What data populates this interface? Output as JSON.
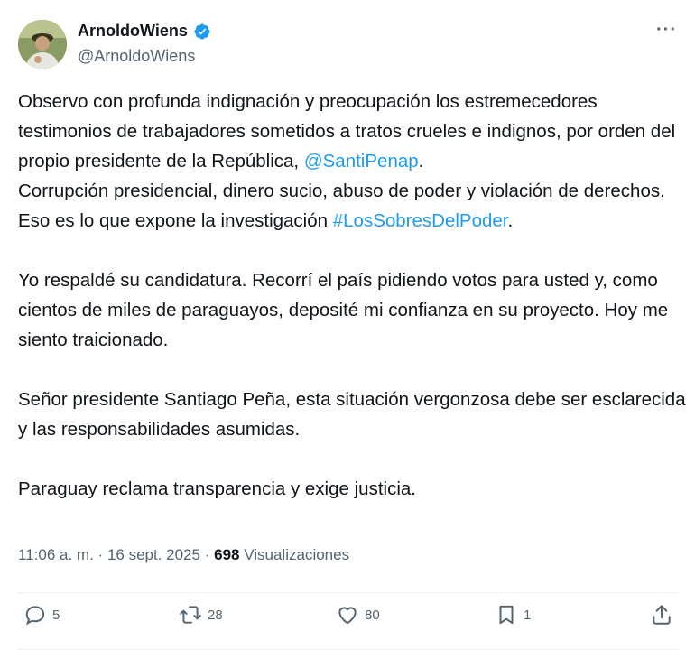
{
  "author": {
    "display_name": "ArnoldoWiens",
    "handle": "@ArnoldoWiens",
    "verified_icon": "verified-badge-icon"
  },
  "more_label": "···",
  "tweet": {
    "p1_text_a": "Observo con profunda indignación y preocupación los estremecedores testimonios de trabajadores sometidos a tratos crueles e indignos, por orden del propio presidente de la República, ",
    "p1_mention": "@SantiPenap",
    "p1_text_b": ".",
    "p2_text_a": "Corrupción presidencial, dinero sucio, abuso de poder y violación de derechos. Eso es lo que expone la investigación ",
    "p2_hashtag": "#LosSobresDelPoder",
    "p2_text_b": ".",
    "p3": "Yo respaldé su candidatura. Recorrí el país pidiendo votos para usted y, como cientos de miles de paraguayos, deposité mi confianza en su proyecto. Hoy me siento traicionado.",
    "p4": "Señor presidente Santiago Peña, esta situación vergonzosa debe ser esclarecida y las responsabilidades asumidas.",
    "p5": "Paraguay reclama transparencia y exige justicia."
  },
  "meta": {
    "time": "11:06 a. m.",
    "separator": "·",
    "date": "16 sept. 2025",
    "views_count": "698",
    "views_label": "Visualizaciones"
  },
  "actions": {
    "replies": "5",
    "reposts": "28",
    "likes": "80",
    "bookmarks": "1"
  },
  "colors": {
    "link": "#1d9bf0",
    "text": "#0f1419",
    "secondary": "#536471",
    "verified": "#1d9bf0"
  }
}
